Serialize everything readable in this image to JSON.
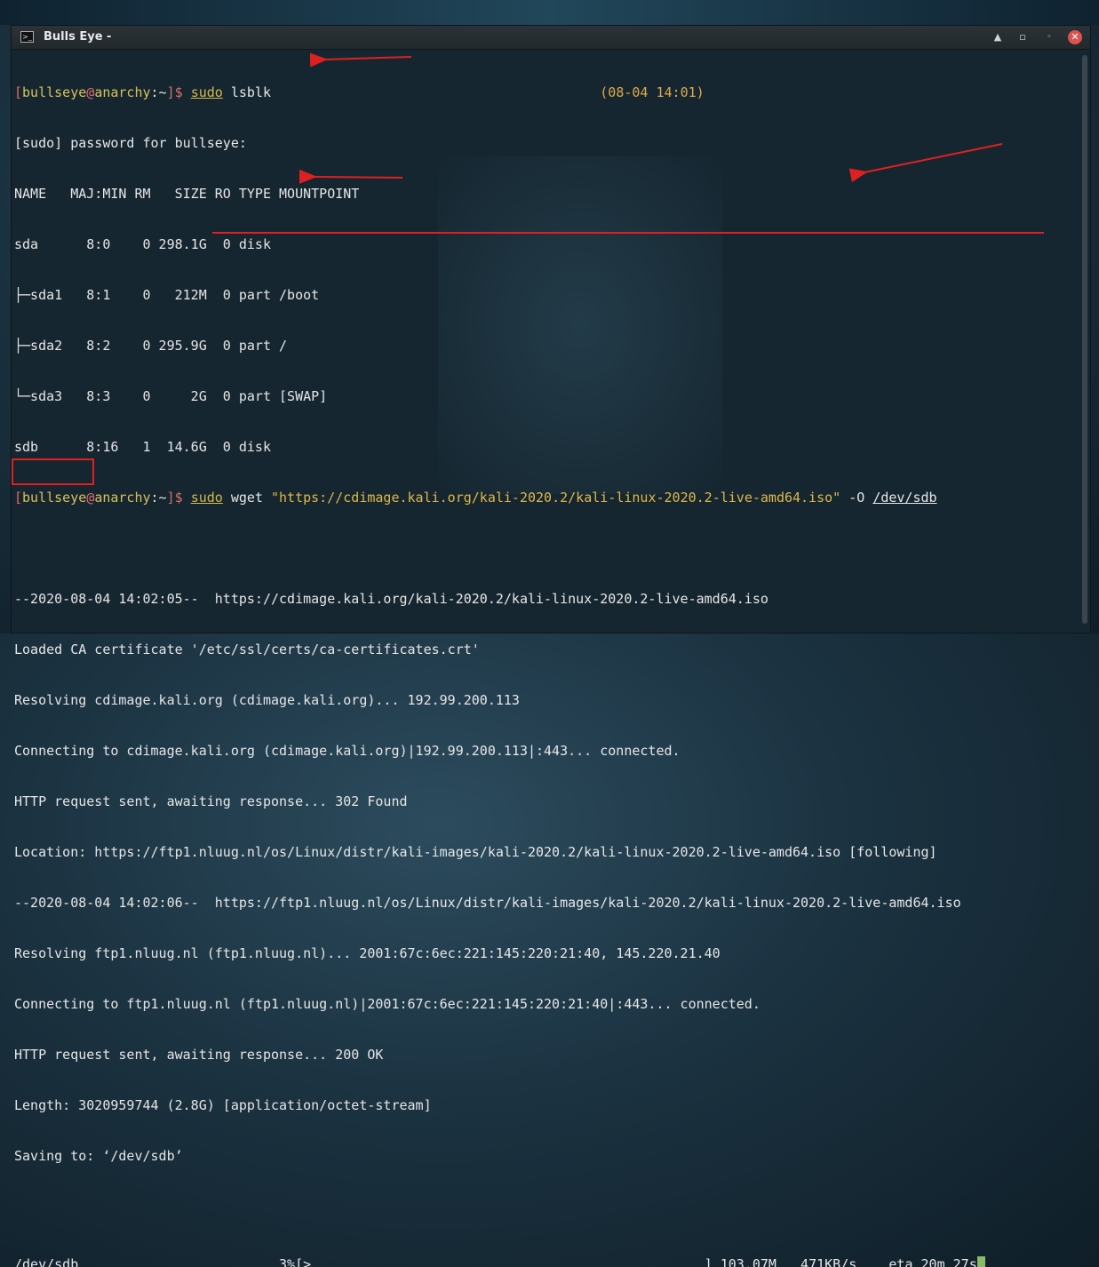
{
  "window": {
    "title": "Bulls Eye -",
    "terminal_icon": "terminal-icon",
    "controls": {
      "minimize": "▲",
      "maximize": "▫",
      "restore": "◦",
      "close": "✕"
    }
  },
  "prompt": {
    "open": "[",
    "user": "bullseye",
    "at": "@",
    "host": "anarchy",
    "path": ":~",
    "close": "]$ "
  },
  "lines": {
    "cmd1_sudo": "sudo",
    "cmd1_rest": " lsblk",
    "cmd1_time": "(08-04 14:01)",
    "l2": "[sudo] password for bullseye:",
    "l3": "NAME   MAJ:MIN RM   SIZE RO TYPE MOUNTPOINT",
    "l4": "sda      8:0    0 298.1G  0 disk",
    "l5": "├─sda1   8:1    0   212M  0 part /boot",
    "l6": "├─sda2   8:2    0 295.9G  0 part /",
    "l7": "└─sda3   8:3    0     2G  0 part [SWAP]",
    "l8": "sdb      8:16   1  14.6G  0 disk",
    "cmd2_sudo": "sudo",
    "cmd2_wget": " wget ",
    "cmd2_url": "\"https://cdimage.kali.org/kali-2020.2/kali-linux-2020.2-live-amd64.iso\"",
    "cmd2_flag": " -O ",
    "cmd2_dest": "/dev/sdb",
    "o1": "--2020-08-04 14:02:05--  https://cdimage.kali.org/kali-2020.2/kali-linux-2020.2-live-amd64.iso",
    "o2": "Loaded CA certificate '/etc/ssl/certs/ca-certificates.crt'",
    "o3": "Resolving cdimage.kali.org (cdimage.kali.org)... 192.99.200.113",
    "o4": "Connecting to cdimage.kali.org (cdimage.kali.org)|192.99.200.113|:443... connected.",
    "o5": "HTTP request sent, awaiting response... 302 Found",
    "o6": "Location: https://ftp1.nluug.nl/os/Linux/distr/kali-images/kali-2020.2/kali-linux-2020.2-live-amd64.iso [following]",
    "o7": "--2020-08-04 14:02:06--  https://ftp1.nluug.nl/os/Linux/distr/kali-images/kali-2020.2/kali-linux-2020.2-live-amd64.iso",
    "o8": "Resolving ftp1.nluug.nl (ftp1.nluug.nl)... 2001:67c:6ec:221:145:220:21:40, 145.220.21.40",
    "o9": "Connecting to ftp1.nluug.nl (ftp1.nluug.nl)|2001:67c:6ec:221:145:220:21:40|:443... connected.",
    "o10": "HTTP request sent, awaiting response... 200 OK",
    "o11": "Length: 3020959744 (2.8G) [application/octet-stream]",
    "o12": "Saving to: ‘/dev/sdb’"
  },
  "progress": {
    "file": "/dev/sdb",
    "percent": "3%",
    "bar_open": "[>",
    "bar_close": "]",
    "downloaded": "103.07M",
    "speed": "471KB/s",
    "eta": "eta 20m 27s"
  },
  "colors": {
    "annotation_red": "#e02020",
    "prompt_bracket": "#e06c6c",
    "prompt_user": "#d9c25a",
    "url_string": "#e0b84a",
    "cursor": "#8cb86a"
  }
}
